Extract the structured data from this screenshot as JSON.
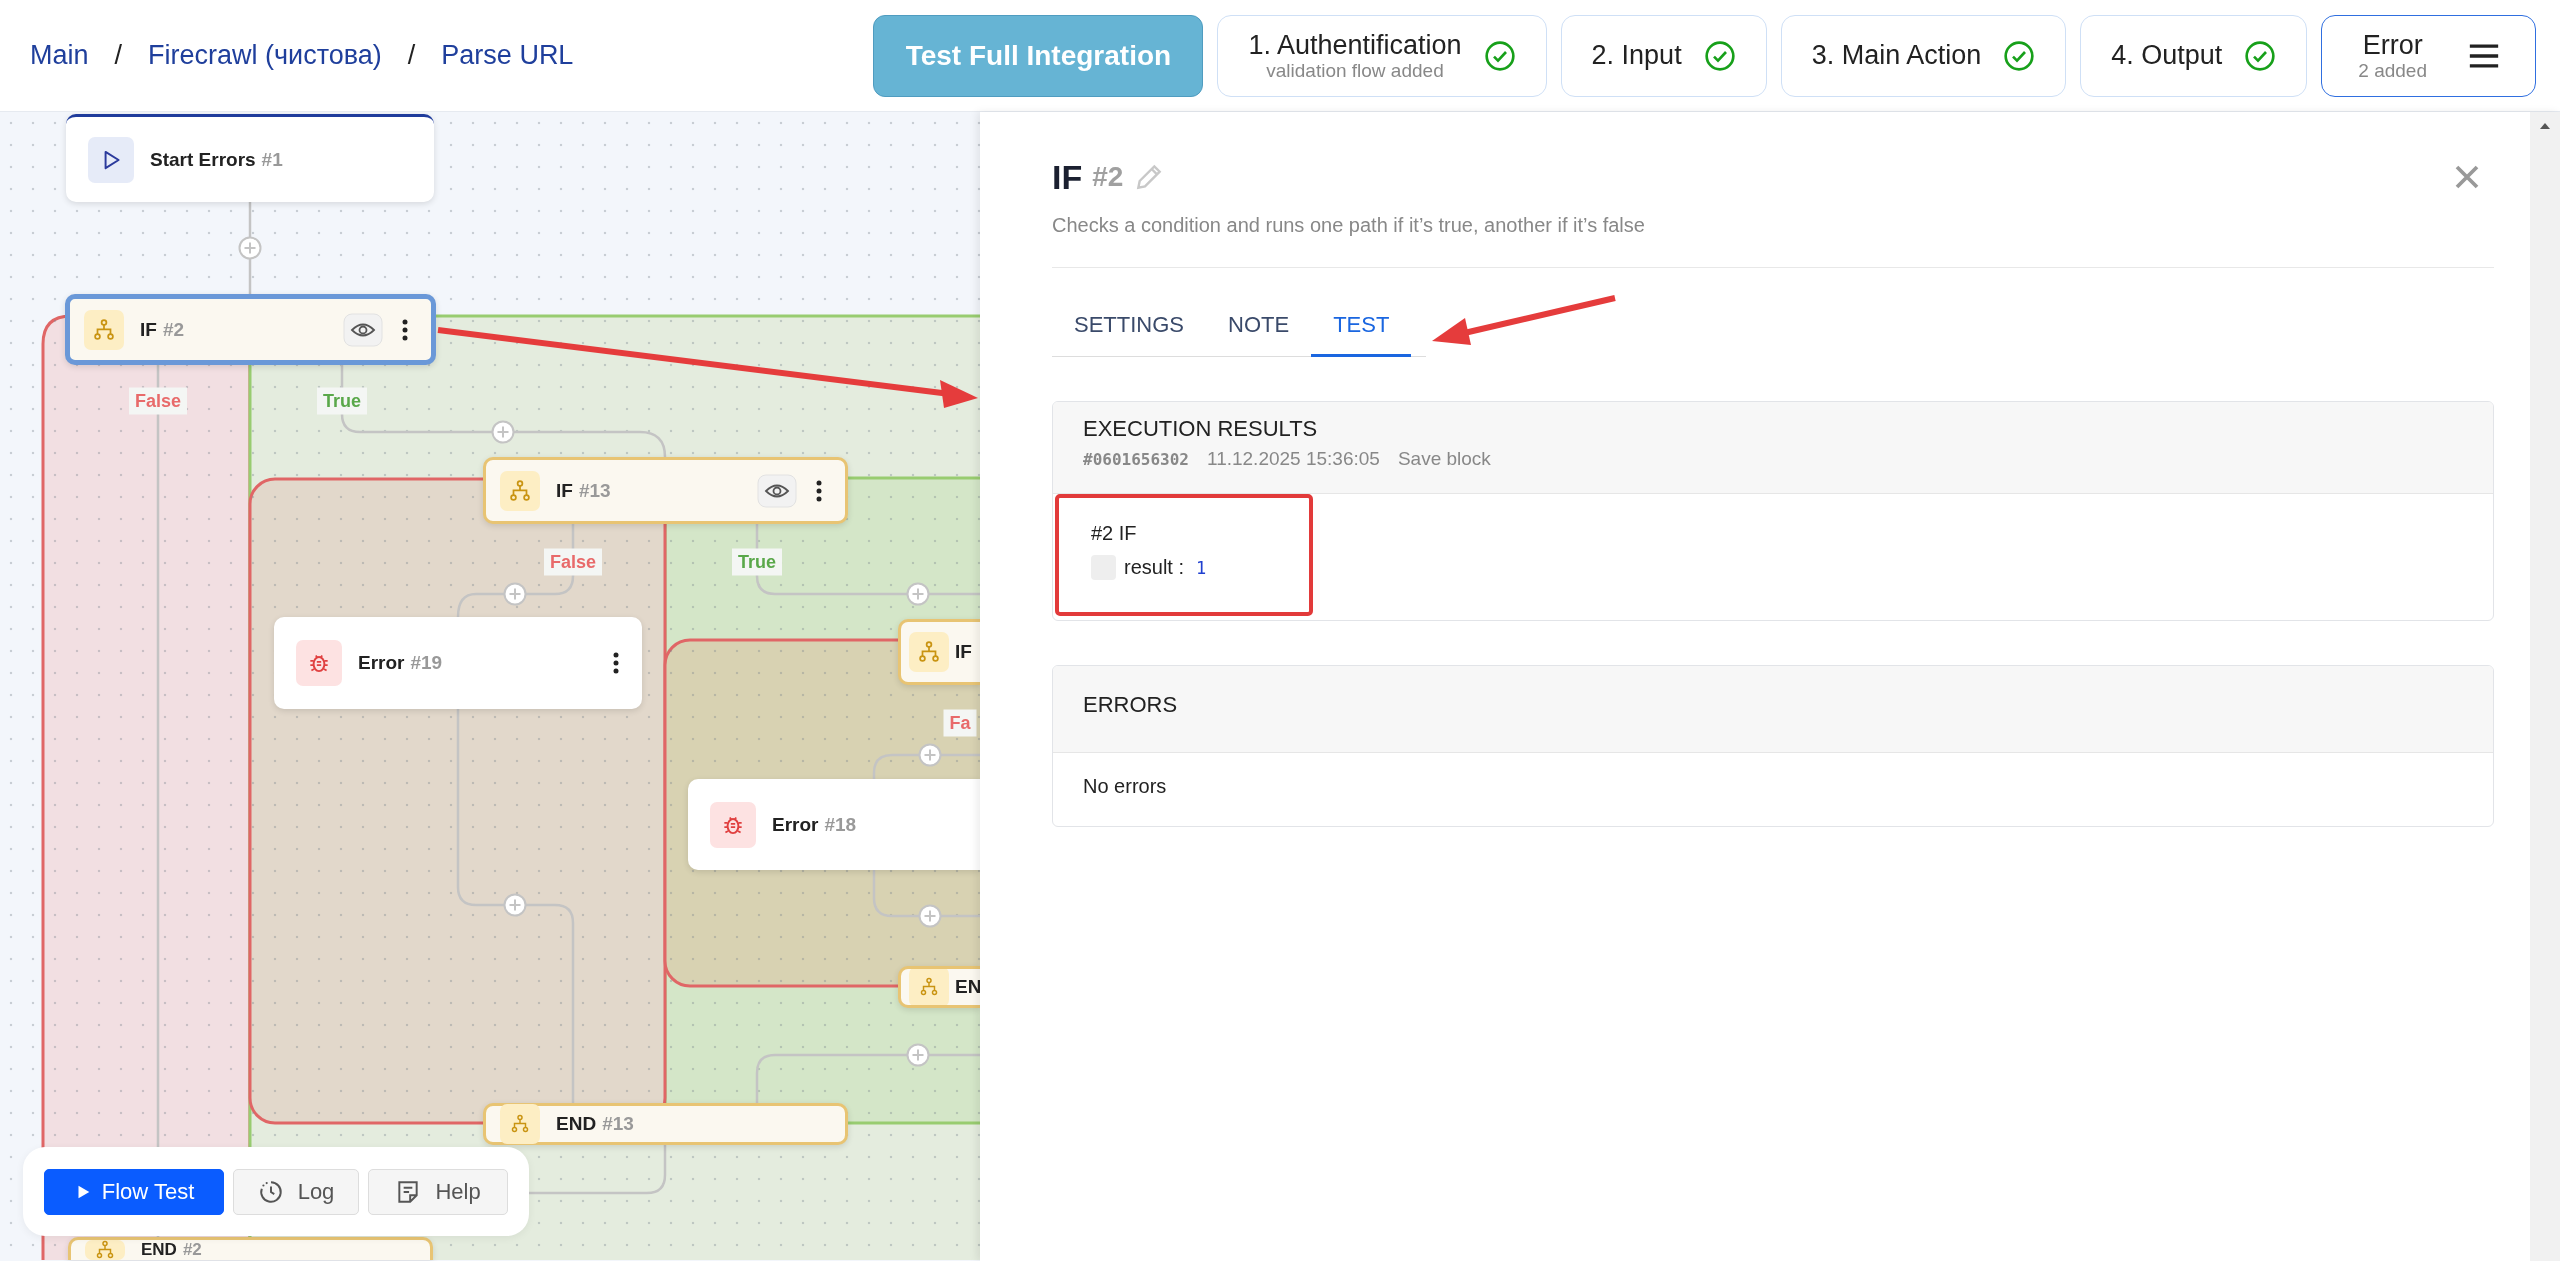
{
  "breadcrumbs": {
    "separator": "/",
    "items": [
      {
        "label": "Main"
      },
      {
        "label": "Firecrawl (чистова)"
      },
      {
        "label": "Parse URL"
      }
    ]
  },
  "test_button": "Test Full Integration",
  "steps": [
    {
      "kind": "step",
      "label": "1. Authentification",
      "sublabel": "validation flow added",
      "completed": true
    },
    {
      "kind": "step",
      "label": "2. Input",
      "completed": true
    },
    {
      "kind": "step",
      "label": "3. Main Action",
      "completed": true
    },
    {
      "kind": "step",
      "label": "4. Output",
      "completed": true
    },
    {
      "kind": "menu",
      "label": "Error",
      "sublabel": "2 added"
    }
  ],
  "canvas": {
    "nodes": [
      {
        "kind": "start",
        "title": "Start Errors",
        "number": "#1",
        "selected": false
      },
      {
        "kind": "if",
        "title": "IF",
        "number": "#2",
        "selected": true
      },
      {
        "kind": "if",
        "title": "IF",
        "number": "#13",
        "selected": false
      },
      {
        "kind": "error",
        "title": "Error",
        "number": "#19",
        "selected": false
      },
      {
        "kind": "if",
        "title": "IF",
        "selected": false
      },
      {
        "kind": "error",
        "title": "Error",
        "number": "#18",
        "selected": false
      },
      {
        "kind": "end",
        "title": "EN",
        "selected": false
      },
      {
        "kind": "end",
        "title": "END",
        "number": "#13",
        "selected": false
      },
      {
        "kind": "end",
        "title": "END",
        "number": "#2",
        "selected": false
      }
    ],
    "branch_labels": [
      {
        "kind": "false",
        "text": "False"
      },
      {
        "kind": "true",
        "text": "True"
      },
      {
        "kind": "false",
        "text": "False"
      },
      {
        "kind": "true",
        "text": "True"
      },
      {
        "kind": "false",
        "text": "Fa"
      }
    ]
  },
  "toolbar": [
    {
      "kind": "primary",
      "label": "Flow Test"
    },
    {
      "kind": "log",
      "label": "Log"
    },
    {
      "kind": "help",
      "label": "Help"
    }
  ],
  "panel": {
    "title": "IF",
    "number": "#2",
    "description": "Checks a condition and runs one path if it’s true, another if it’s false",
    "tabs": [
      {
        "label": "SETTINGS",
        "selected": false
      },
      {
        "label": "NOTE",
        "selected": false
      },
      {
        "label": "TEST",
        "selected": true
      }
    ],
    "execution": {
      "title": "EXECUTION RESULTS",
      "run_id": "#0601656302",
      "timestamp": "11.12.2025 15:36:05",
      "source": "Save block",
      "block_title": "#2 IF",
      "fields": [
        {
          "label": "result :",
          "value": "1"
        }
      ]
    },
    "errors": {
      "title": "ERRORS",
      "message": "No errors"
    }
  }
}
